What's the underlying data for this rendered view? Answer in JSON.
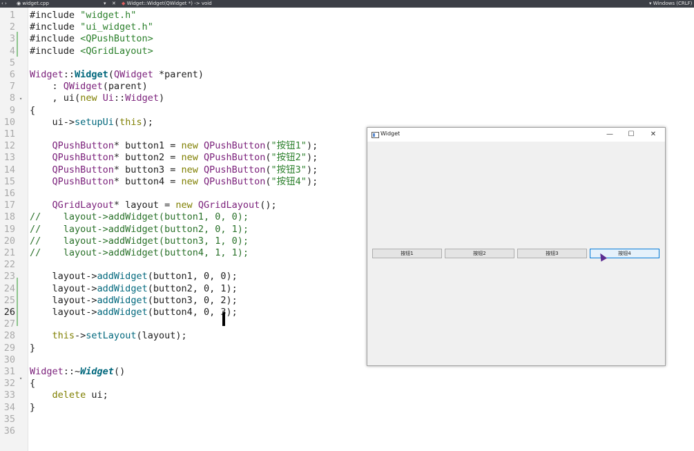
{
  "topbar": {
    "file_tab": "widget.cpp",
    "function_crumb": "Widget::Widget(QWidget *) -> void",
    "platform": "Windows (CRLF)"
  },
  "editor": {
    "current_line": 26,
    "line_numbers": [
      "1",
      "2",
      "3",
      "4",
      "5",
      "6",
      "7",
      "8",
      "9",
      "10",
      "11",
      "12",
      "13",
      "14",
      "15",
      "16",
      "17",
      "18",
      "19",
      "20",
      "21",
      "22",
      "23",
      "24",
      "25",
      "26",
      "27",
      "28",
      "29",
      "30",
      "31",
      "32",
      "33",
      "34",
      "35",
      "36"
    ]
  },
  "code": {
    "l1": [
      [
        "#include ",
        "k-pre"
      ],
      [
        "\"widget.h\"",
        "s"
      ]
    ],
    "l2": [
      [
        "#include ",
        "k-pre"
      ],
      [
        "\"ui_widget.h\"",
        "s"
      ]
    ],
    "l3": [
      [
        "#include ",
        "k-pre"
      ],
      [
        "<QPushButton>",
        "s"
      ]
    ],
    "l4": [
      [
        "#include ",
        "k-pre"
      ],
      [
        "<QGridLayout>",
        "s"
      ]
    ],
    "l5": [],
    "l6": [
      [
        "Widget",
        "t"
      ],
      [
        "::",
        ""
      ],
      [
        "Widget",
        "fb"
      ],
      [
        "(",
        ""
      ],
      [
        "QWidget",
        "t"
      ],
      [
        " *parent)",
        ""
      ]
    ],
    "l7": [
      [
        "    : ",
        ""
      ],
      [
        "QWidget",
        "t"
      ],
      [
        "(parent)",
        ""
      ]
    ],
    "l8": [
      [
        "    , ",
        ""
      ],
      [
        "ui",
        "var"
      ],
      [
        "(",
        ""
      ],
      [
        "new",
        "kw"
      ],
      [
        " ",
        ""
      ],
      [
        "Ui",
        "t"
      ],
      [
        "::",
        ""
      ],
      [
        "Widget",
        "t"
      ],
      [
        ")",
        ""
      ]
    ],
    "l9": [
      [
        "{",
        ""
      ]
    ],
    "l10": [
      [
        "    ui->",
        ""
      ],
      [
        "setupUi",
        "f"
      ],
      [
        "(",
        ""
      ],
      [
        "this",
        "kw"
      ],
      [
        ");",
        ""
      ]
    ],
    "l11": [],
    "l12": [
      [
        "    ",
        ""
      ],
      [
        "QPushButton",
        "t"
      ],
      [
        "* button1 = ",
        ""
      ],
      [
        "new",
        "kw"
      ],
      [
        " ",
        ""
      ],
      [
        "QPushButton",
        "t"
      ],
      [
        "(",
        ""
      ],
      [
        "\"按钮1\"",
        "s"
      ],
      [
        ");",
        ""
      ]
    ],
    "l13": [
      [
        "    ",
        ""
      ],
      [
        "QPushButton",
        "t"
      ],
      [
        "* button2 = ",
        ""
      ],
      [
        "new",
        "kw"
      ],
      [
        " ",
        ""
      ],
      [
        "QPushButton",
        "t"
      ],
      [
        "(",
        ""
      ],
      [
        "\"按钮2\"",
        "s"
      ],
      [
        ");",
        ""
      ]
    ],
    "l14": [
      [
        "    ",
        ""
      ],
      [
        "QPushButton",
        "t"
      ],
      [
        "* button3 = ",
        ""
      ],
      [
        "new",
        "kw"
      ],
      [
        " ",
        ""
      ],
      [
        "QPushButton",
        "t"
      ],
      [
        "(",
        ""
      ],
      [
        "\"按钮3\"",
        "s"
      ],
      [
        ");",
        ""
      ]
    ],
    "l15": [
      [
        "    ",
        ""
      ],
      [
        "QPushButton",
        "t"
      ],
      [
        "* button4 = ",
        ""
      ],
      [
        "new",
        "kw"
      ],
      [
        " ",
        ""
      ],
      [
        "QPushButton",
        "t"
      ],
      [
        "(",
        ""
      ],
      [
        "\"按钮4\"",
        "s"
      ],
      [
        ");",
        ""
      ]
    ],
    "l16": [],
    "l17": [
      [
        "    ",
        ""
      ],
      [
        "QGridLayout",
        "t"
      ],
      [
        "* layout = ",
        ""
      ],
      [
        "new",
        "kw"
      ],
      [
        " ",
        ""
      ],
      [
        "QGridLayout",
        "t"
      ],
      [
        "();",
        ""
      ]
    ],
    "l18": [
      [
        "//    layout->addWidget(button1, 0, 0);",
        "cm"
      ]
    ],
    "l19": [
      [
        "//    layout->addWidget(button2, 0, 1);",
        "cm"
      ]
    ],
    "l20": [
      [
        "//    layout->addWidget(button3, 1, 0);",
        "cm"
      ]
    ],
    "l21": [
      [
        "//    layout->addWidget(button4, 1, 1);",
        "cm"
      ]
    ],
    "l22": [],
    "l23": [
      [
        "    layout->",
        ""
      ],
      [
        "addWidget",
        "f"
      ],
      [
        "(button1, 0, 0);",
        ""
      ]
    ],
    "l24": [
      [
        "    layout->",
        ""
      ],
      [
        "addWidget",
        "f"
      ],
      [
        "(button2, 0, 1);",
        ""
      ]
    ],
    "l25": [
      [
        "    layout->",
        ""
      ],
      [
        "addWidget",
        "f"
      ],
      [
        "(button3, 0, 2);",
        ""
      ]
    ],
    "l26": [
      [
        "    layout->",
        ""
      ],
      [
        "addWidget",
        "f"
      ],
      [
        "(button4, 0, 3);",
        ""
      ]
    ],
    "l27": [],
    "l28": [
      [
        "    ",
        ""
      ],
      [
        "this",
        "kw"
      ],
      [
        "->",
        ""
      ],
      [
        "setLayout",
        "f"
      ],
      [
        "(layout);",
        ""
      ]
    ],
    "l29": [
      [
        "}",
        ""
      ]
    ],
    "l30": [],
    "l31": [
      [
        "Widget",
        "t"
      ],
      [
        "::~",
        ""
      ],
      [
        "Widget",
        "fi"
      ],
      [
        "()",
        ""
      ]
    ],
    "l32": [
      [
        "{",
        ""
      ]
    ],
    "l33": [
      [
        "    ",
        ""
      ],
      [
        "delete",
        "kw"
      ],
      [
        " ui;",
        ""
      ]
    ],
    "l34": [
      [
        "}",
        ""
      ]
    ],
    "l35": [],
    "l36": []
  },
  "window": {
    "title": "Widget",
    "minimize": "—",
    "maximize": "☐",
    "close": "✕",
    "buttons": [
      "按钮1",
      "按钮2",
      "按钮3",
      "按钮4"
    ],
    "hovered_button_index": 3
  }
}
